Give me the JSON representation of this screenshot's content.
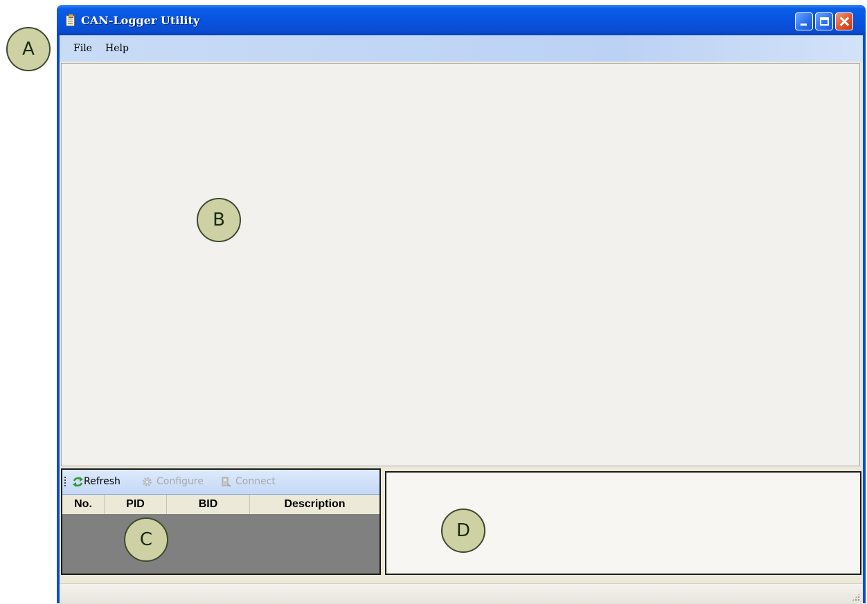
{
  "window": {
    "title": "CAN-Logger Utility"
  },
  "menubar": {
    "items": [
      {
        "label": "File"
      },
      {
        "label": "Help"
      }
    ]
  },
  "toolbar": {
    "buttons": [
      {
        "label": "Refresh",
        "icon": "refresh-icon",
        "enabled": true
      },
      {
        "label": "Configure",
        "icon": "gear-icon",
        "enabled": false
      },
      {
        "label": "Connect",
        "icon": "connect-icon",
        "enabled": false
      }
    ]
  },
  "device_table": {
    "columns": [
      "No.",
      "PID",
      "BID",
      "Description"
    ],
    "rows": []
  },
  "callouts": {
    "a": "A",
    "b": "B",
    "c": "C",
    "d": "D"
  },
  "colors": {
    "titlebar": "#0754e0",
    "menubar": "#c8dcf6",
    "panel_bg": "#ece9d8",
    "table_empty": "#808080",
    "callout_fill": "#cdd1a4"
  }
}
